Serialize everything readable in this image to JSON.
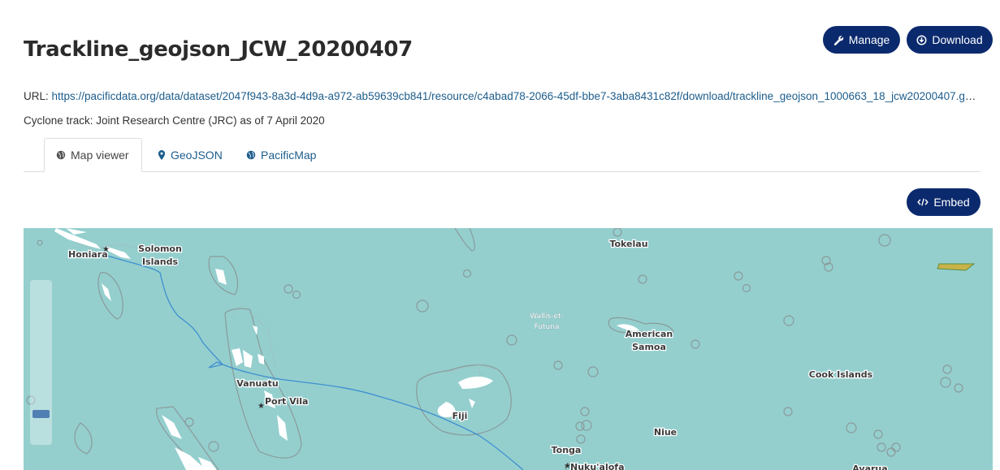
{
  "page": {
    "title": "Trackline_geojson_JCW_20200407",
    "url_label": "URL:",
    "url": "https://pacificdata.org/data/dataset/2047f943-8a3d-4d9a-a972-ab59639cb841/resource/c4abad78-2066-45df-bbe7-3aba8431c82f/download/trackline_geojson_1000663_18_jcw20200407.geojson",
    "description": "Cyclone track: Joint Research Centre (JRC) as of 7 April 2020"
  },
  "actions": {
    "manage_label": "Manage",
    "manage_icon": "wrench-icon",
    "download_label": "Download",
    "download_icon": "download-circle-icon",
    "embed_label": "Embed",
    "embed_icon": "code-icon"
  },
  "tabs": [
    {
      "label": "Map viewer",
      "icon": "globe-icon",
      "active": true
    },
    {
      "label": "GeoJSON",
      "icon": "map-marker-icon",
      "active": false
    },
    {
      "label": "PacificMap",
      "icon": "globe-icon",
      "active": false
    }
  ],
  "map": {
    "water_color": "#94cfce",
    "track_color": "#3f8fd0",
    "labels": {
      "honiara": "Honiara",
      "solomon_1": "Solomon",
      "solomon_2": "Islands",
      "tokelau": "Tokelau",
      "wallis_1": "Wallis-et-",
      "wallis_2": "Futuna",
      "american_1": "American",
      "american_2": "Samoa",
      "cook": "Cook Islands",
      "vanuatu": "Vanuatu",
      "port_vila": "Port Vila",
      "fiji": "Fiji",
      "niue": "Niue",
      "tonga": "Tonga",
      "nukualofa": "Nuku'alofa",
      "avarua": "Avarua"
    }
  }
}
